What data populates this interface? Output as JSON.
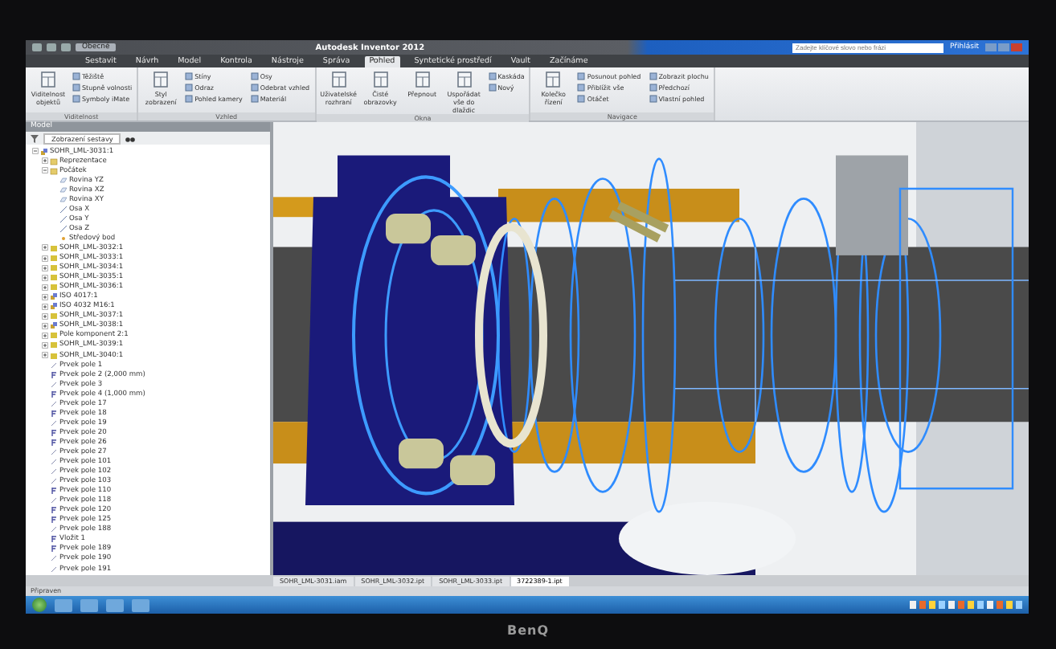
{
  "window": {
    "title": "Autodesk Inventor 2012",
    "quick_access": {
      "dropdown": "Obecné"
    },
    "search": {
      "placeholder": "Zadejte klíčové slovo nebo frázi"
    },
    "sign_in": "Přihlásit"
  },
  "ribbon_tabs": [
    {
      "label": "Sestavit",
      "selected": false
    },
    {
      "label": "Návrh",
      "selected": false
    },
    {
      "label": "Model",
      "selected": false
    },
    {
      "label": "Kontrola",
      "selected": false
    },
    {
      "label": "Nástroje",
      "selected": false
    },
    {
      "label": "Správa",
      "selected": false
    },
    {
      "label": "Pohled",
      "selected": true
    },
    {
      "label": "Syntetické prostředí",
      "selected": false
    },
    {
      "label": "Vault",
      "selected": false
    },
    {
      "label": "Začínáme",
      "selected": false
    }
  ],
  "ribbon_panels": [
    {
      "title": "Viditelnost",
      "large": [
        "Viditelnost objektů"
      ],
      "small": [
        "Těžiště",
        "Stupně volnosti",
        "Symboly iMate"
      ]
    },
    {
      "title": "Vzhled",
      "large": [
        "Styl zobrazení"
      ],
      "small": [
        "Stíny",
        "Odraz",
        "Pohled kamery",
        "Osy",
        "Odebrat vzhled",
        "Materiál"
      ]
    },
    {
      "title": "Okna",
      "large": [
        "Uživatelské rozhraní",
        "Čisté obrazovky",
        "Přepnout",
        "Uspořádat vše do dlaždic"
      ],
      "small": [
        "Kaskáda",
        "Nový"
      ]
    },
    {
      "title": "Navigace",
      "large": [
        "Kolečko řízení"
      ],
      "small": [
        "Posunout pohled",
        "Přiblížit vše",
        "Otáčet",
        "Zobrazit plochu",
        "Předchozí",
        "Vlastní pohled"
      ]
    }
  ],
  "browser": {
    "title": "Model",
    "filter": "Zobrazení sestavy",
    "tree": [
      {
        "label": "SOHR_LML-3031:1",
        "kind": "assembly",
        "expanded": true,
        "children": [
          {
            "label": "Reprezentace",
            "kind": "folder",
            "expanded": false
          },
          {
            "label": "Počátek",
            "kind": "folder",
            "expanded": true,
            "children": [
              {
                "label": "Rovina YZ",
                "kind": "plane"
              },
              {
                "label": "Rovina XZ",
                "kind": "plane"
              },
              {
                "label": "Rovina XY",
                "kind": "plane"
              },
              {
                "label": "Osa X",
                "kind": "axis"
              },
              {
                "label": "Osa Y",
                "kind": "axis"
              },
              {
                "label": "Osa Z",
                "kind": "axis"
              },
              {
                "label": "Středový bod",
                "kind": "point"
              }
            ]
          },
          {
            "label": "SOHR_LML-3032:1",
            "kind": "part",
            "expanded": false
          },
          {
            "label": "SOHR_LML-3033:1",
            "kind": "part",
            "expanded": false
          },
          {
            "label": "SOHR_LML-3034:1",
            "kind": "part",
            "expanded": false
          },
          {
            "label": "SOHR_LML-3035:1",
            "kind": "part",
            "expanded": false
          },
          {
            "label": "SOHR_LML-3036:1",
            "kind": "part",
            "expanded": false
          },
          {
            "label": "ISO 4017:1",
            "kind": "assembly",
            "expanded": false
          },
          {
            "label": "ISO 4032 M16:1",
            "kind": "assembly",
            "expanded": false
          },
          {
            "label": "SOHR_LML-3037:1",
            "kind": "part",
            "expanded": false
          },
          {
            "label": "SOHR_LML-3038:1",
            "kind": "assembly",
            "expanded": false
          },
          {
            "label": "Pole komponent 2:1",
            "kind": "part",
            "expanded": false
          },
          {
            "label": "SOHR_LML-3039:1",
            "kind": "part",
            "expanded": false
          },
          {
            "label": "SOHR_LML-3040:1",
            "kind": "part",
            "expanded": false
          },
          {
            "label": "Prvek pole 1",
            "kind": "constraint"
          },
          {
            "label": "Prvek pole 2 (2,000 mm)",
            "kind": "flush"
          },
          {
            "label": "Prvek pole 3",
            "kind": "constraint"
          },
          {
            "label": "Prvek pole 4 (1,000 mm)",
            "kind": "flush"
          },
          {
            "label": "Prvek pole 17",
            "kind": "constraint"
          },
          {
            "label": "Prvek pole 18",
            "kind": "flush"
          },
          {
            "label": "Prvek pole 19",
            "kind": "constraint"
          },
          {
            "label": "Prvek pole 20",
            "kind": "flush"
          },
          {
            "label": "Prvek pole 26",
            "kind": "flush"
          },
          {
            "label": "Prvek pole 27",
            "kind": "constraint"
          },
          {
            "label": "Prvek pole 101",
            "kind": "constraint"
          },
          {
            "label": "Prvek pole 102",
            "kind": "constraint"
          },
          {
            "label": "Prvek pole 103",
            "kind": "constraint"
          },
          {
            "label": "Prvek pole 110",
            "kind": "flush"
          },
          {
            "label": "Prvek pole 118",
            "kind": "constraint"
          },
          {
            "label": "Prvek pole 120",
            "kind": "flush"
          },
          {
            "label": "Prvek pole 125",
            "kind": "flush"
          },
          {
            "label": "Prvek pole 188",
            "kind": "constraint"
          },
          {
            "label": "Vložit 1",
            "kind": "flush"
          },
          {
            "label": "Prvek pole 189",
            "kind": "flush"
          },
          {
            "label": "Prvek pole 190",
            "kind": "constraint"
          },
          {
            "label": "Prvek pole 191",
            "kind": "constraint"
          }
        ]
      }
    ]
  },
  "document_tabs": [
    {
      "label": "SOHR_LML-3031.iam",
      "selected": false
    },
    {
      "label": "SOHR_LML-3032.ipt",
      "selected": false
    },
    {
      "label": "SOHR_LML-3033.ipt",
      "selected": false
    },
    {
      "label": "3722389-1.ipt",
      "selected": true
    }
  ],
  "status_bar": {
    "text": "Připraven"
  },
  "monitor": {
    "brand": "BenQ"
  }
}
